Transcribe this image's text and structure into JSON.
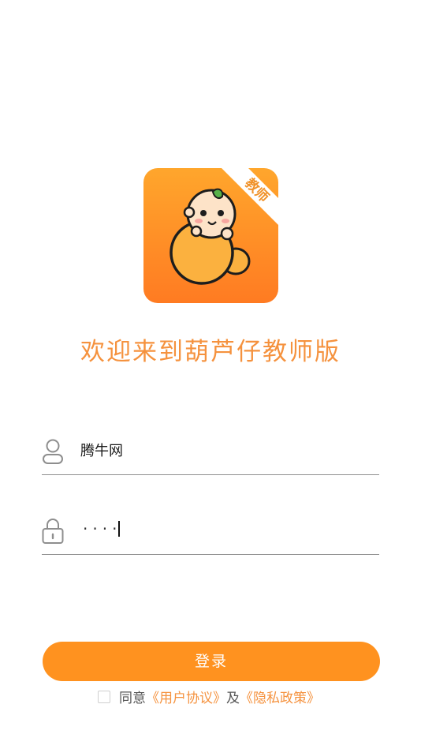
{
  "logo": {
    "badge_text": "教师",
    "bg_color_top": "#ffa42a",
    "bg_color_bottom": "#ff7d24"
  },
  "welcome_text": "欢迎来到葫芦仔教师版",
  "username": {
    "value": "腾牛网",
    "icon": "user-icon"
  },
  "password": {
    "masked_value": "····",
    "icon": "lock-icon"
  },
  "login_button": {
    "label": "登录",
    "color": "#ff921f"
  },
  "agreement": {
    "prefix": "同意",
    "user_agreement": "《用户协议》",
    "conjunction": "及",
    "privacy_policy": "《隐私政策》",
    "link_color": "#f5923e"
  }
}
